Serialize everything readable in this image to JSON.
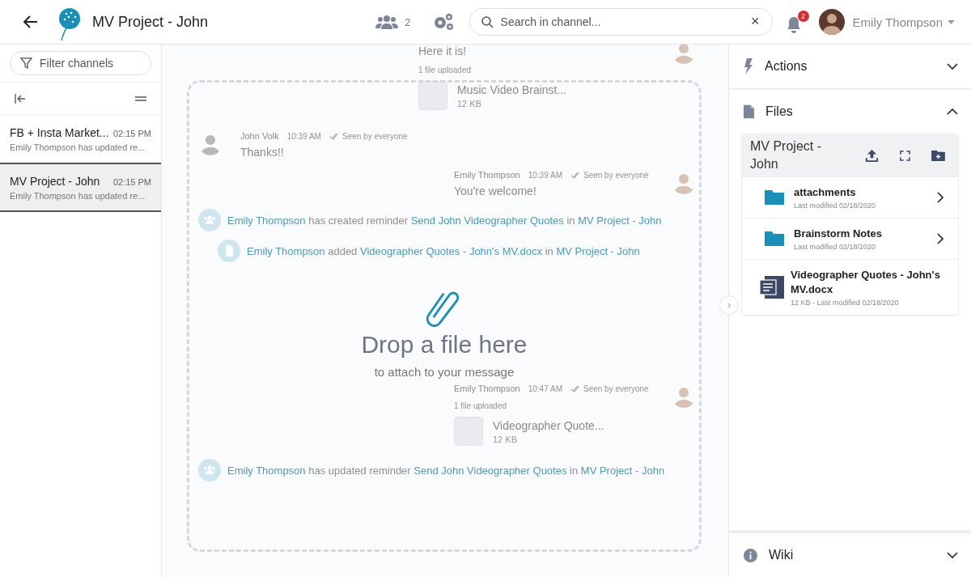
{
  "header": {
    "title": "MV Project - John",
    "members_count": "2",
    "search": {
      "placeholder": "Search in channel...",
      "clear": "×"
    },
    "notifications_count": "2",
    "user_name": "Emily Thompson"
  },
  "sidebar": {
    "filter_placeholder": "Filter channels",
    "channels": [
      {
        "name": "FB + Insta Market...",
        "time": "02:15 PM",
        "preview": "Emily Thompson has updated re...",
        "selected": false
      },
      {
        "name": "MV Project - John",
        "time": "02:15 PM",
        "preview": "Emily Thompson has updated re...",
        "selected": true
      }
    ]
  },
  "chat": {
    "messages": [
      {
        "kind": "outgoing",
        "text": "Here it is!",
        "upload_label": "1 file uploaded",
        "file": {
          "name": "Music Video Brainst...",
          "size": "12 KB"
        }
      },
      {
        "kind": "incoming",
        "author": "John Volk",
        "time": "10:39 AM",
        "status": "Seen by everyone",
        "text": "Thanks!!"
      },
      {
        "kind": "outgoing",
        "author": "Emily Thompson",
        "time": "10:39 AM",
        "status": "Seen by everyone",
        "text": "You're welcome!"
      },
      {
        "kind": "reminder",
        "parts": [
          {
            "text": "Emily Thompson",
            "link": true
          },
          {
            "text": "has created reminder",
            "link": false
          },
          {
            "text": "Send John Videographer Quotes",
            "link": true
          },
          {
            "text": "in",
            "link": false
          },
          {
            "text": "MV Project - John",
            "link": true
          }
        ]
      },
      {
        "kind": "file_added",
        "parts": [
          {
            "text": "Emily Thompson",
            "link": true
          },
          {
            "text": "added",
            "link": false
          },
          {
            "text": "Videographer Quotes - John's MV.docx",
            "link": true
          },
          {
            "text": "in",
            "link": false
          },
          {
            "text": "MV Project - John",
            "link": true
          }
        ]
      },
      {
        "kind": "outgoing",
        "author": "Emily Thompson",
        "time": "10:47 AM",
        "status": "Seen by everyone",
        "upload_label": "1 file uploaded",
        "file": {
          "name": "Videographer Quote...",
          "size": "12 KB"
        }
      },
      {
        "kind": "reminder",
        "parts": [
          {
            "text": "Emily Thompson",
            "link": true
          },
          {
            "text": "has updated reminder",
            "link": false
          },
          {
            "text": "Send John Videographer Quotes",
            "link": true
          },
          {
            "text": "in",
            "link": false
          },
          {
            "text": "MV Project - John",
            "link": true
          }
        ]
      }
    ]
  },
  "drop_zone": {
    "title": "Drop a file here",
    "subtitle": "to attach to your message"
  },
  "panel": {
    "sections": [
      {
        "kind": "actions",
        "title": "Actions",
        "expanded": false
      },
      {
        "kind": "files",
        "title": "Files",
        "expanded": true
      },
      {
        "kind": "wiki",
        "title": "Wiki",
        "expanded": false
      }
    ],
    "files": {
      "folder_title": "MV Project - John",
      "items": [
        {
          "kind": "folder",
          "name": "attachments",
          "meta": "Last modified 02/18/2020"
        },
        {
          "kind": "folder",
          "name": "Brainstorm Notes",
          "meta": "Last modified 02/18/2020"
        },
        {
          "kind": "document",
          "name": "Videographer Quotes - John's MV.docx",
          "meta": "12 KB - Last modified 02/18/2020"
        }
      ]
    }
  }
}
